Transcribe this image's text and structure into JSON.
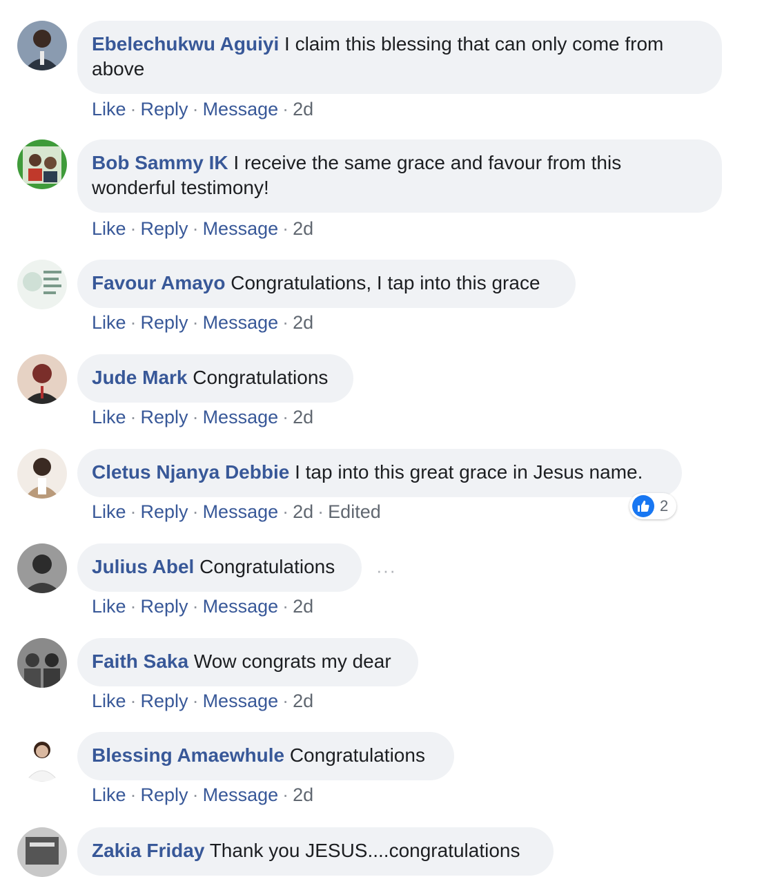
{
  "actions": {
    "like": "Like",
    "reply": "Reply",
    "message": "Message",
    "separator": "·"
  },
  "comments": [
    {
      "author": "Ebelechukwu Aguiyi",
      "text": "I claim this blessing that can only come from above",
      "time": "2d",
      "avatar_colors": [
        "#3b4a5c",
        "#8a9bb0"
      ],
      "avatar_icon": "avatar-man-suit-icon"
    },
    {
      "author": "Bob Sammy IK",
      "text": "I receive the same grace and favour from this wonderful testimony!",
      "time": "2d",
      "avatar_colors": [
        "#3f9b3a",
        "#d8e6d0"
      ],
      "avatar_icon": "avatar-group-photo-icon"
    },
    {
      "author": "Favour Amayo",
      "text": "Congratulations, I tap into this grace",
      "time": "2d",
      "avatar_colors": [
        "#cfe0d6",
        "#7a9a8a"
      ],
      "avatar_icon": "avatar-text-image-icon"
    },
    {
      "author": "Jude Mark",
      "text": "Congratulations",
      "time": "2d",
      "avatar_colors": [
        "#7a2e2a",
        "#e6d2c4"
      ],
      "avatar_icon": "avatar-man-portrait-icon"
    },
    {
      "author": "Cletus Njanya Debbie",
      "text": "I tap into this great grace in Jesus name.",
      "time": "2d",
      "edited": "Edited",
      "reaction_count": "2",
      "avatar_colors": [
        "#b99a7a",
        "#f2ece6"
      ],
      "avatar_icon": "avatar-woman-portrait-icon"
    },
    {
      "author": "Julius Abel",
      "text": "Congratulations",
      "time": "2d",
      "more": "···",
      "avatar_colors": [
        "#2c2c2c",
        "#9a9a9a"
      ],
      "avatar_icon": "avatar-person-dark-icon"
    },
    {
      "author": "Faith Saka",
      "text": "Wow congrats my dear",
      "time": "2d",
      "avatar_colors": [
        "#3a3a3a",
        "#8a8a8a"
      ],
      "avatar_icon": "avatar-group-bw-icon"
    },
    {
      "author": "Blessing Amaewhule",
      "text": "Congratulations",
      "time": "2d",
      "avatar_colors": [
        "#d9b8a0",
        "#ffffff"
      ],
      "avatar_icon": "avatar-woman-white-icon"
    },
    {
      "author": "Zakia Friday",
      "text": "Thank you JESUS....congratulations",
      "avatar_colors": [
        "#555555",
        "#c8c8c8"
      ],
      "avatar_icon": "avatar-poster-icon"
    }
  ]
}
